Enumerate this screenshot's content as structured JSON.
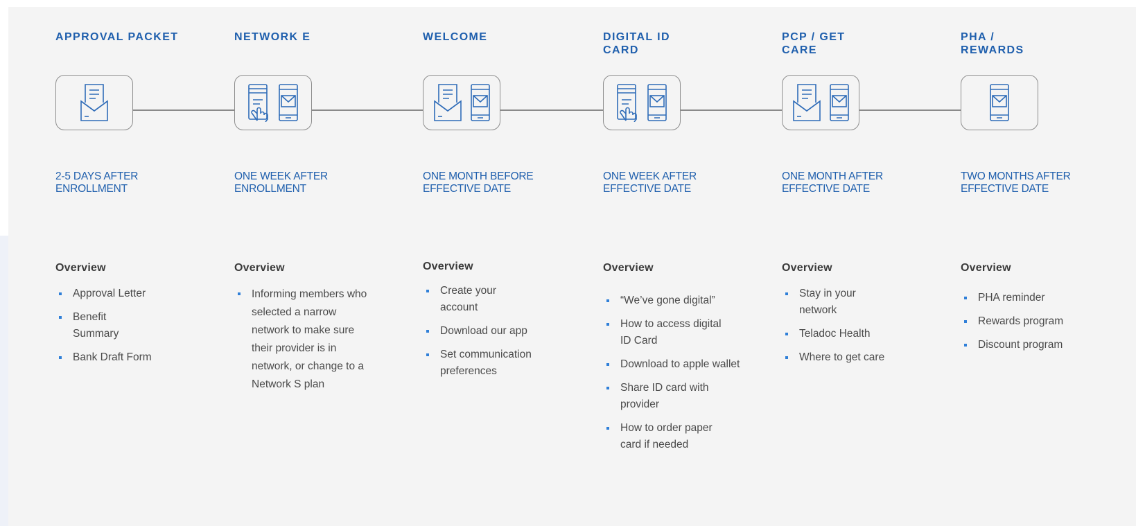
{
  "colors": {
    "accent": "#1f5fad",
    "bullet": "#2f7fd8",
    "panel": "#f4f4f4",
    "text": "#4a4a4a"
  },
  "steps": [
    {
      "title": "APPROVAL PACKET",
      "icons": [
        "envelope-letter-icon"
      ],
      "timing": "2-5 DAYS AFTER ENROLLMENT",
      "overview_label": "Overview",
      "items": [
        "Approval Letter",
        "Benefit Summary",
        "Bank Draft Form"
      ]
    },
    {
      "title": "NETWORK E",
      "icons": [
        "hand-tap-screen-icon",
        "phone-email-icon"
      ],
      "timing": "ONE WEEK AFTER ENROLLMENT",
      "overview_label": "Overview",
      "items": [
        "Informing members who selected a narrow network to make sure their provider is in network, or change to a Network S plan"
      ]
    },
    {
      "title": "WELCOME",
      "icons": [
        "envelope-letter-icon",
        "phone-email-icon"
      ],
      "timing": "ONE MONTH BEFORE EFFECTIVE DATE",
      "overview_label": "Overview",
      "items": [
        "Create your account",
        "Download our app",
        "Set communication preferences"
      ]
    },
    {
      "title": "DIGITAL ID CARD",
      "icons": [
        "hand-tap-screen-icon",
        "phone-email-icon"
      ],
      "timing": "ONE WEEK AFTER EFFECTIVE DATE",
      "overview_label": "Overview",
      "items": [
        "“We’ve gone digital”",
        "How to access digital ID Card",
        "Download to apple wallet",
        "Share ID card with provider",
        "How to order paper card if needed"
      ]
    },
    {
      "title": "PCP / GET CARE",
      "icons": [
        "envelope-letter-icon",
        "phone-email-icon"
      ],
      "timing": "ONE MONTH AFTER EFFECTIVE DATE",
      "overview_label": "Overview",
      "items": [
        "Stay in your network",
        "Teladoc Health",
        "Where to get care"
      ]
    },
    {
      "title": "PHA / REWARDS",
      "icons": [
        "phone-email-icon"
      ],
      "timing": "TWO MONTHS AFTER EFFECTIVE DATE",
      "overview_label": "Overview",
      "items": [
        "PHA reminder",
        "Rewards program",
        "Discount program"
      ]
    }
  ]
}
